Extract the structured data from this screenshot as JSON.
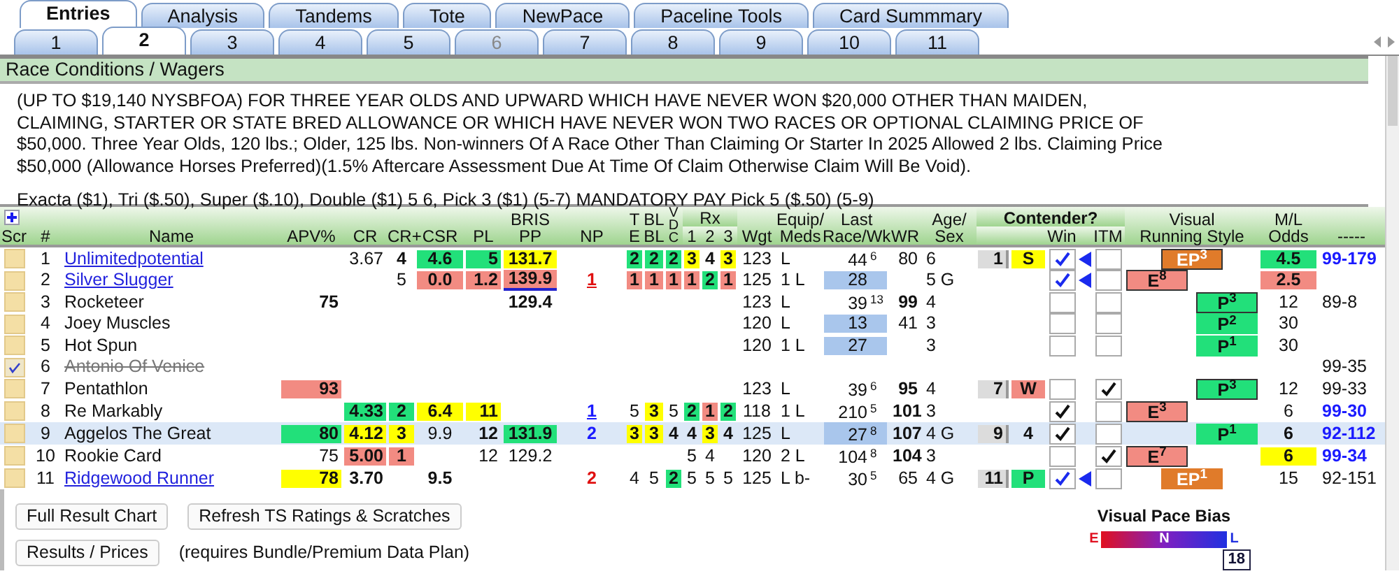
{
  "main_tabs": [
    {
      "label": "Entries",
      "selected": true
    },
    {
      "label": "Analysis",
      "selected": false
    },
    {
      "label": "Tandems",
      "selected": false
    },
    {
      "label": "Tote",
      "selected": false
    },
    {
      "label": "NewPace",
      "selected": false
    },
    {
      "label": "Paceline Tools",
      "selected": false
    },
    {
      "label": "Card Summmary",
      "selected": false
    }
  ],
  "race_tabs": [
    {
      "label": "1",
      "selected": false,
      "disabled": false
    },
    {
      "label": "2",
      "selected": true,
      "disabled": false
    },
    {
      "label": "3",
      "selected": false,
      "disabled": false
    },
    {
      "label": "4",
      "selected": false,
      "disabled": false
    },
    {
      "label": "5",
      "selected": false,
      "disabled": false
    },
    {
      "label": "6",
      "selected": false,
      "disabled": true
    },
    {
      "label": "7",
      "selected": false,
      "disabled": false
    },
    {
      "label": "8",
      "selected": false,
      "disabled": false
    },
    {
      "label": "9",
      "selected": false,
      "disabled": false
    },
    {
      "label": "10",
      "selected": false,
      "disabled": false
    },
    {
      "label": "11",
      "selected": false,
      "disabled": false
    }
  ],
  "conditions": {
    "title": "Race Conditions / Wagers",
    "lines": [
      "(UP TO $19,140 NYSBFOA) FOR THREE YEAR OLDS AND UPWARD WHICH HAVE NEVER WON $20,000 OTHER THAN MAIDEN,",
      "CLAIMING, STARTER OR STATE BRED ALLOWANCE OR WHICH HAVE NEVER WON TWO RACES OR OPTIONAL CLAIMING PRICE OF",
      "$50,000. Three Year Olds, 120 lbs.; Older, 125 lbs. Non-winners Of A Race Other Than Claiming Or Starter In 2025 Allowed 2 lbs. Claiming Price",
      "$50,000 (Allowance Horses Preferred)(1.5% Aftercare Assessment Due At Time Of Claim Otherwise Claim Will Be Void)."
    ],
    "wagers": "Exacta ($1), Tri ($.50), Super ($.10), Double ($1) 5 6, Pick 3 ($1) (5-7) MANDATORY PAY Pick 5 ($.50) (5-9)"
  },
  "table": {
    "columns": [
      {
        "label": [
          "Scr"
        ],
        "kind": "scratch"
      },
      {
        "label": [
          "#"
        ]
      },
      {
        "label": [
          "Name"
        ],
        "kind": "name"
      },
      {
        "label": [
          "APV%"
        ]
      },
      {
        "label": [
          "CR"
        ]
      },
      {
        "label": [
          "CR+"
        ]
      },
      {
        "label": [
          "CSR"
        ]
      },
      {
        "label": [
          "PL"
        ]
      },
      {
        "label": [
          "BRIS",
          "PP"
        ]
      },
      {
        "label": [
          "NP"
        ],
        "kind": "ink"
      },
      {
        "label": [
          "T",
          "E"
        ]
      },
      {
        "label": [
          "BL",
          "BL"
        ]
      },
      {
        "label": [
          "V",
          "D",
          "C"
        ]
      },
      {
        "label": [
          "Rx"
        ],
        "colspan": 3,
        "children": [
          {
            "label": [
              "1"
            ]
          },
          {
            "label": [
              "2"
            ]
          },
          {
            "label": [
              "3"
            ]
          }
        ]
      },
      {
        "label": [
          "Wgt"
        ]
      },
      {
        "label": [
          "Equip/",
          "Meds"
        ]
      },
      {
        "label": [
          "Last",
          "Race/Wk"
        ]
      },
      {
        "label": [
          "WR"
        ]
      },
      {
        "label": [
          "Age/",
          "Sex"
        ]
      },
      {
        "label": [
          "Contender?"
        ],
        "bold": true,
        "colspan": 5,
        "children": [
          {
            "kind": "post"
          },
          {
            "kind": "tag"
          },
          {
            "label": [
              "Win"
            ],
            "kind": "check"
          },
          {
            "kind": "pointer"
          },
          {
            "label": [
              "ITM"
            ],
            "kind": "check"
          }
        ]
      },
      {
        "label": [
          "Visual",
          "Running Style"
        ],
        "kind": "style"
      },
      {
        "label": [
          "M/L",
          "Odds"
        ]
      },
      {
        "label": [
          "-----"
        ],
        "kind": "ink"
      }
    ],
    "rows": [
      {
        "selected": false,
        "scratched": false,
        "cells": [
          null,
          "1",
          {
            "text": "Unlimitedpotential",
            "link": true
          },
          null,
          "3.67",
          {
            "text": "4",
            "bold": true
          },
          {
            "text": "4.6",
            "color": "#22e07a",
            "bold": true
          },
          {
            "text": "5",
            "color": "#22e07a",
            "bold": true
          },
          {
            "text": "131.7",
            "color": "#ffff00",
            "bold": true
          },
          null,
          {
            "text": "2",
            "color": "#22e07a",
            "bold": true
          },
          {
            "text": "2",
            "color": "#22e07a",
            "bold": true
          },
          {
            "text": "2",
            "color": "#22e07a",
            "bold": true
          },
          {
            "text": "3",
            "color": "#ffff00",
            "bold": true
          },
          {
            "text": "4",
            "bold": true
          },
          {
            "text": "3",
            "color": "#ffff00",
            "bold": true
          },
          "123",
          "L",
          {
            "text": "44",
            "sup": "6"
          },
          "80",
          "6",
          "1",
          {
            "text": "S",
            "color": "#ffff00"
          },
          {
            "checked": true,
            "flag": true
          },
          null,
          {
            "checked": false
          },
          {
            "text": "EP",
            "sup": "3",
            "kind": "EP",
            "color": "#e07b2a",
            "bordered": true
          },
          {
            "text": "4.5",
            "color": "#22e07a",
            "bold": true
          },
          {
            "text": "99-179",
            "color": "#1a1aff",
            "bold": true
          }
        ]
      },
      {
        "selected": false,
        "scratched": false,
        "cells": [
          null,
          "2",
          {
            "text": "Silver Slugger",
            "link": true
          },
          null,
          null,
          "5",
          {
            "text": "0.0",
            "color": "#f28b82",
            "bold": true
          },
          {
            "text": "1.2",
            "color": "#f28b82",
            "bold": true
          },
          {
            "text": "139.9",
            "color": "#f28b82",
            "bold": true,
            "underline": true
          },
          {
            "text": "1",
            "color": "#e01010",
            "bold": true,
            "underline": true
          },
          {
            "text": "1",
            "color": "#f28b82",
            "bold": true
          },
          {
            "text": "1",
            "color": "#f28b82",
            "bold": true
          },
          {
            "text": "1",
            "color": "#f28b82",
            "bold": true
          },
          {
            "text": "1",
            "color": "#f28b82",
            "bold": true
          },
          {
            "text": "2",
            "color": "#22e07a",
            "bold": true
          },
          {
            "text": "1",
            "color": "#f28b82",
            "bold": true
          },
          "125",
          "1 L",
          {
            "text": "28",
            "color": "#a9c6ec"
          },
          null,
          "5 G",
          null,
          null,
          {
            "checked": true,
            "flag": true
          },
          null,
          {
            "checked": false
          },
          {
            "text": "E",
            "sup": "8",
            "kind": "E",
            "color": "#f28b82",
            "bordered": true
          },
          {
            "text": "2.5",
            "color": "#f28b82",
            "bold": true
          },
          null
        ]
      },
      {
        "selected": false,
        "scratched": false,
        "cells": [
          null,
          "3",
          "Rocketeer",
          {
            "text": "75",
            "bold": true
          },
          null,
          null,
          null,
          null,
          {
            "text": "129.4",
            "bold": true
          },
          null,
          null,
          null,
          null,
          null,
          null,
          null,
          "123",
          "L",
          {
            "text": "39",
            "sup": "13"
          },
          {
            "text": "99",
            "bold": true
          },
          "4",
          null,
          null,
          {
            "checked": false
          },
          null,
          {
            "checked": false
          },
          {
            "text": "P",
            "sup": "3",
            "kind": "P",
            "color": "#22e07a",
            "bordered": true
          },
          "12",
          "89-8"
        ]
      },
      {
        "selected": false,
        "scratched": false,
        "cells": [
          null,
          "4",
          "Joey Muscles",
          null,
          null,
          null,
          null,
          null,
          null,
          null,
          null,
          null,
          null,
          null,
          null,
          null,
          "120",
          "L",
          {
            "text": "13",
            "color": "#a9c6ec"
          },
          "41",
          "3",
          null,
          null,
          {
            "checked": false
          },
          null,
          {
            "checked": false
          },
          {
            "text": "P",
            "sup": "2",
            "kind": "P",
            "color": "#22e07a",
            "bordered": false
          },
          "30",
          null
        ]
      },
      {
        "selected": false,
        "scratched": false,
        "cells": [
          null,
          "5",
          "Hot Spun",
          null,
          null,
          null,
          null,
          null,
          null,
          null,
          null,
          null,
          null,
          null,
          null,
          null,
          "120",
          "1 L",
          {
            "text": "27",
            "color": "#a9c6ec"
          },
          null,
          "3",
          null,
          null,
          {
            "checked": false
          },
          null,
          {
            "checked": false
          },
          {
            "text": "P",
            "sup": "1",
            "kind": "P",
            "color": "#22e07a",
            "bordered": false
          },
          "30",
          null
        ]
      },
      {
        "selected": false,
        "scratched": true,
        "cells": [
          null,
          "6",
          "Antonio Of Venice",
          null,
          null,
          null,
          null,
          null,
          null,
          null,
          null,
          null,
          null,
          null,
          null,
          null,
          null,
          null,
          null,
          null,
          null,
          null,
          null,
          null,
          null,
          null,
          null,
          null,
          "99-35"
        ]
      },
      {
        "selected": false,
        "scratched": false,
        "cells": [
          null,
          "7",
          "Pentathlon",
          {
            "text": "93",
            "color": "#f28b82",
            "bold": true
          },
          null,
          null,
          null,
          null,
          null,
          null,
          null,
          null,
          null,
          null,
          null,
          null,
          "123",
          "L",
          {
            "text": "39",
            "sup": "6"
          },
          {
            "text": "95",
            "bold": true
          },
          "4",
          "7",
          {
            "text": "W",
            "color": "#f28b82"
          },
          {
            "checked": false
          },
          null,
          {
            "checked": true
          },
          {
            "text": "P",
            "sup": "3",
            "kind": "P",
            "color": "#22e07a",
            "bordered": true
          },
          "12",
          "99-33"
        ]
      },
      {
        "selected": false,
        "scratched": false,
        "cells": [
          null,
          "8",
          "Re Markably",
          null,
          {
            "text": "4.33",
            "color": "#22e07a",
            "bold": true
          },
          {
            "text": "2",
            "color": "#22e07a",
            "bold": true
          },
          {
            "text": "6.4",
            "color": "#ffff00",
            "bold": true
          },
          {
            "text": "11",
            "color": "#ffff00",
            "bold": true
          },
          null,
          {
            "text": "1",
            "color": "#1a1aff",
            "bold": true,
            "underline": true
          },
          "5",
          {
            "text": "3",
            "color": "#ffff00",
            "bold": true
          },
          "5",
          {
            "text": "2",
            "color": "#22e07a",
            "bold": true
          },
          {
            "text": "1",
            "color": "#f28b82",
            "bold": true
          },
          {
            "text": "2",
            "color": "#22e07a",
            "bold": true
          },
          "118",
          "1 L",
          {
            "text": "210",
            "sup": "5"
          },
          {
            "text": "101",
            "bold": true
          },
          "3",
          null,
          null,
          {
            "checked": true,
            "flag": false
          },
          null,
          {
            "checked": false
          },
          {
            "text": "E",
            "sup": "3",
            "kind": "E",
            "color": "#f28b82",
            "bordered": true
          },
          "6",
          {
            "text": "99-30",
            "color": "#1a1aff",
            "bold": true
          }
        ]
      },
      {
        "selected": true,
        "scratched": false,
        "cells": [
          null,
          "9",
          "Aggelos The Great",
          {
            "text": "80",
            "color": "#22e07a",
            "bold": true
          },
          {
            "text": "4.12",
            "color": "#ffff00",
            "bold": true
          },
          {
            "text": "3",
            "color": "#ffff00",
            "bold": true
          },
          "9.9",
          {
            "text": "12",
            "bold": true
          },
          {
            "text": "131.9",
            "color": "#22e07a",
            "bold": true
          },
          {
            "text": "2",
            "color": "#1a1aff",
            "bold": true
          },
          {
            "text": "3",
            "color": "#ffff00",
            "bold": true
          },
          {
            "text": "3",
            "color": "#ffff00",
            "bold": true
          },
          {
            "text": "4",
            "bold": true
          },
          {
            "text": "4",
            "bold": true
          },
          {
            "text": "3",
            "color": "#ffff00",
            "bold": true
          },
          {
            "text": "4",
            "bold": true
          },
          "125",
          "L",
          {
            "text": "27",
            "sup": "8",
            "color": "#a9c6ec"
          },
          {
            "text": "107",
            "bold": true
          },
          "4 G",
          "9",
          "4",
          {
            "checked": true,
            "flag": false
          },
          null,
          {
            "checked": false
          },
          {
            "text": "P",
            "sup": "1",
            "kind": "P",
            "color": "#22e07a",
            "bordered": false
          },
          {
            "text": "6",
            "bold": true
          },
          {
            "text": "92-112",
            "color": "#1a1aff",
            "bold": true
          }
        ]
      },
      {
        "selected": false,
        "scratched": false,
        "cells": [
          null,
          "10",
          "Rookie Card",
          "75",
          {
            "text": "5.00",
            "color": "#f28b82",
            "bold": true
          },
          {
            "text": "1",
            "color": "#f28b82",
            "bold": true
          },
          null,
          "12",
          "129.2",
          null,
          null,
          null,
          null,
          "5",
          "4",
          null,
          "120",
          "2 L",
          {
            "text": "104",
            "sup": "8"
          },
          {
            "text": "104",
            "bold": true
          },
          "3",
          null,
          null,
          {
            "checked": false
          },
          null,
          {
            "checked": true
          },
          {
            "text": "E",
            "sup": "7",
            "kind": "E",
            "color": "#f28b82",
            "bordered": true
          },
          {
            "text": "6",
            "color": "#ffff00",
            "bold": true
          },
          {
            "text": "99-34",
            "color": "#1a1aff",
            "bold": true
          }
        ]
      },
      {
        "selected": false,
        "scratched": false,
        "cells": [
          null,
          "11",
          {
            "text": "Ridgewood Runner",
            "link": true
          },
          {
            "text": "78",
            "color": "#ffff00",
            "bold": true
          },
          {
            "text": "3.70",
            "bold": true
          },
          null,
          {
            "text": "9.5",
            "bold": true
          },
          null,
          null,
          {
            "text": "2",
            "color": "#e01010",
            "bold": true
          },
          "4",
          "5",
          {
            "text": "2",
            "color": "#22e07a",
            "bold": true
          },
          "5",
          "5",
          "5",
          "125",
          "L b-",
          {
            "text": "30",
            "sup": "5"
          },
          "65",
          "4 G",
          "11",
          {
            "text": "P",
            "color": "#22e07a"
          },
          {
            "checked": true,
            "flag": true
          },
          null,
          {
            "checked": false
          },
          {
            "text": "EP",
            "sup": "1",
            "kind": "EP",
            "color": "#e07b2a",
            "bordered": false
          },
          "15",
          "92-151"
        ]
      }
    ]
  },
  "buttons": [
    {
      "label": "Full Result Chart"
    },
    {
      "label": "Refresh TS Ratings & Scratches"
    },
    {
      "label": "Results / Prices"
    }
  ],
  "note": "(requires Bundle/Premium Data Plan)",
  "pace_bias": {
    "title": "Visual Pace Bias",
    "labels": [
      "E",
      "N",
      "L"
    ],
    "value": "18"
  }
}
